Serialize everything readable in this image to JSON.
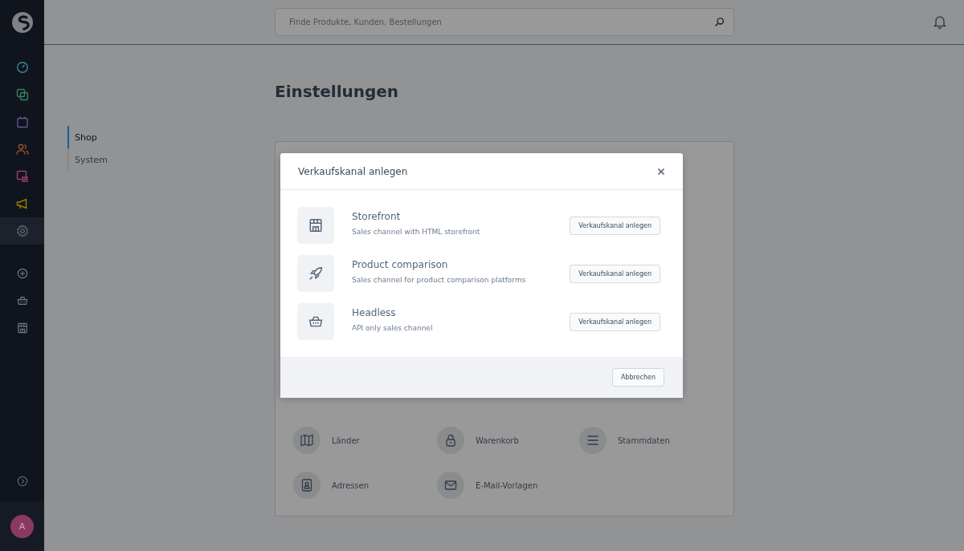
{
  "search": {
    "placeholder": "Finde Produkte, Kunden, Bestellungen"
  },
  "sidebar": {
    "main": [
      {
        "kind": "dashboard",
        "color": "#3a8a99",
        "selected": false
      },
      {
        "kind": "catalog",
        "color": "#348262",
        "selected": false
      },
      {
        "kind": "orders",
        "color": "#605890",
        "selected": false
      },
      {
        "kind": "customers",
        "color": "#955238",
        "selected": false
      },
      {
        "kind": "content",
        "color": "#993e6c",
        "selected": false
      },
      {
        "kind": "marketing",
        "color": "#998100",
        "selected": false
      },
      {
        "kind": "settings",
        "color": "#60646a",
        "selected": true
      }
    ],
    "channels": [
      {
        "kind": "add"
      },
      {
        "kind": "basket"
      },
      {
        "kind": "store"
      }
    ],
    "avatar": "A"
  },
  "page": {
    "title": "Einstellungen",
    "tabs": [
      {
        "label": "Shop",
        "selected": true
      },
      {
        "label": "System",
        "selected": false
      }
    ],
    "items": [
      {
        "kind": "map",
        "label": "Länder"
      },
      {
        "kind": "lock",
        "label": "Warenkorb"
      },
      {
        "kind": "lines",
        "label": "Stammdaten"
      },
      {
        "kind": "contact",
        "label": "Adressen"
      },
      {
        "kind": "mail",
        "label": "E-Mail-Vorlagen"
      }
    ]
  },
  "modal": {
    "title": "Verkaufskanal anlegen",
    "options": [
      {
        "kind": "store",
        "name": "Storefront",
        "description": "Sales channel with HTML storefront",
        "action": "Verkaufskanal anlegen"
      },
      {
        "kind": "rocket",
        "name": "Product comparison",
        "description": "Sales channel for product comparison platforms",
        "action": "Verkaufskanal anlegen"
      },
      {
        "kind": "basket",
        "name": "Headless",
        "description": "API only sales channel",
        "action": "Verkaufskanal anlegen"
      }
    ],
    "cancel": "Abbrechen"
  }
}
